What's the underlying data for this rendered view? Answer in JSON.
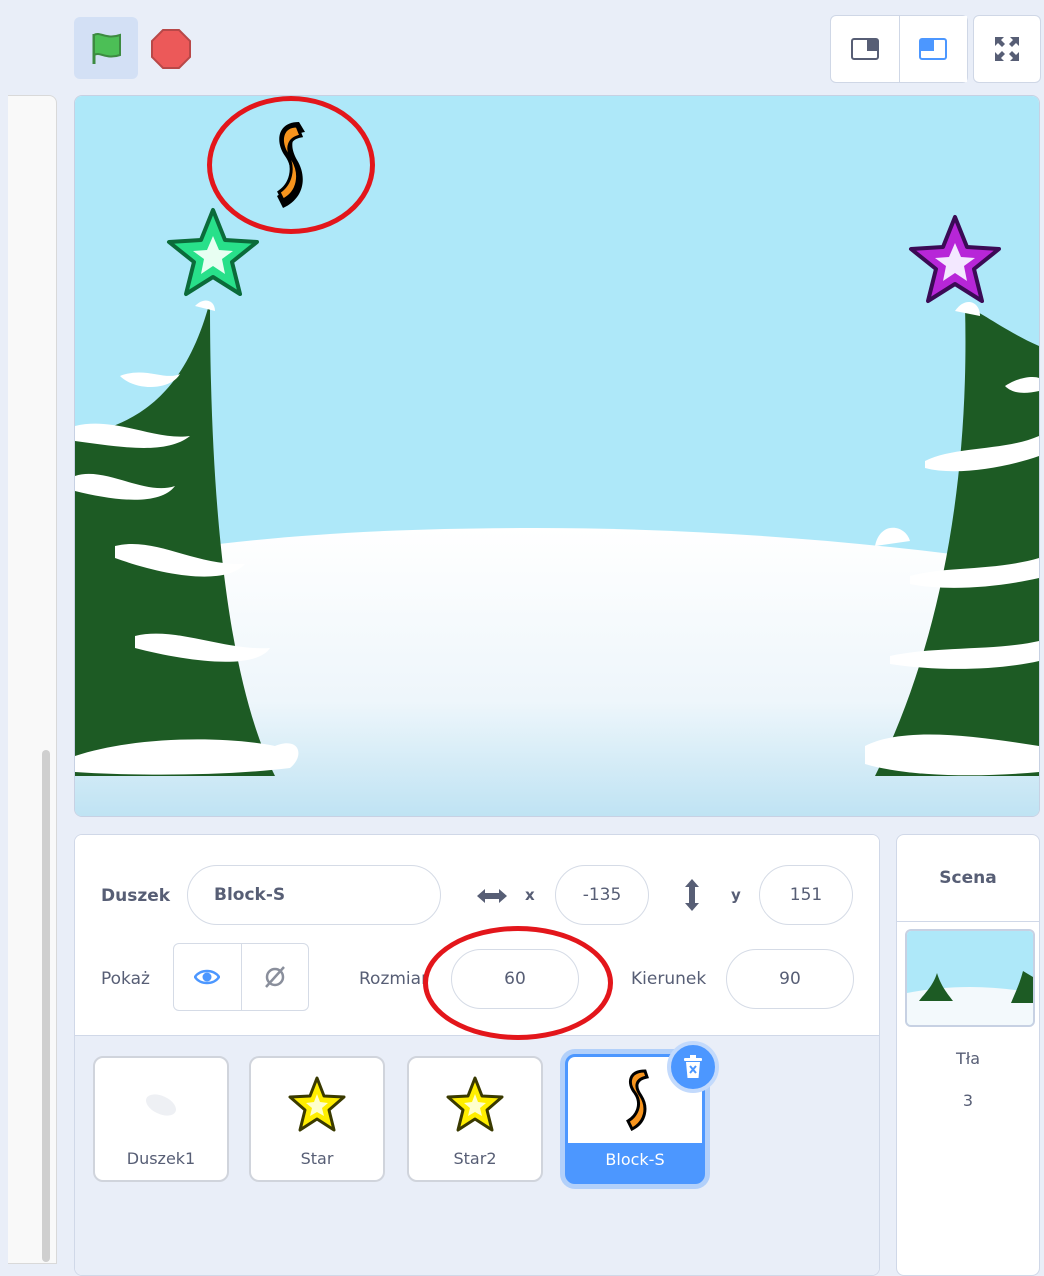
{
  "colors": {
    "accent": "#4c97ff",
    "flag": "#4cbf56",
    "stop": "#ec5959",
    "annotation": "#e3161b",
    "sky": "#aee8f9",
    "tree": "#1d5b24"
  },
  "toolbar": {
    "green_flag_icon": "green-flag-icon",
    "stop_icon": "stop-icon"
  },
  "sprite_info": {
    "sprite_label": "Duszek",
    "sprite_name": "Block-S",
    "x_label": "x",
    "x_value": "-135",
    "y_label": "y",
    "y_value": "151",
    "show_label": "Pokaż",
    "size_label": "Rozmiar",
    "size_value": "60",
    "direction_label": "Kierunek",
    "direction_value": "90"
  },
  "sprites": [
    {
      "name": "Duszek1",
      "selected": false
    },
    {
      "name": "Star",
      "selected": false
    },
    {
      "name": "Star2",
      "selected": false
    },
    {
      "name": "Block-S",
      "selected": true
    }
  ],
  "stage_pane": {
    "title": "Scena",
    "backdrops_label": "Tła",
    "backdrops_count": "3"
  }
}
